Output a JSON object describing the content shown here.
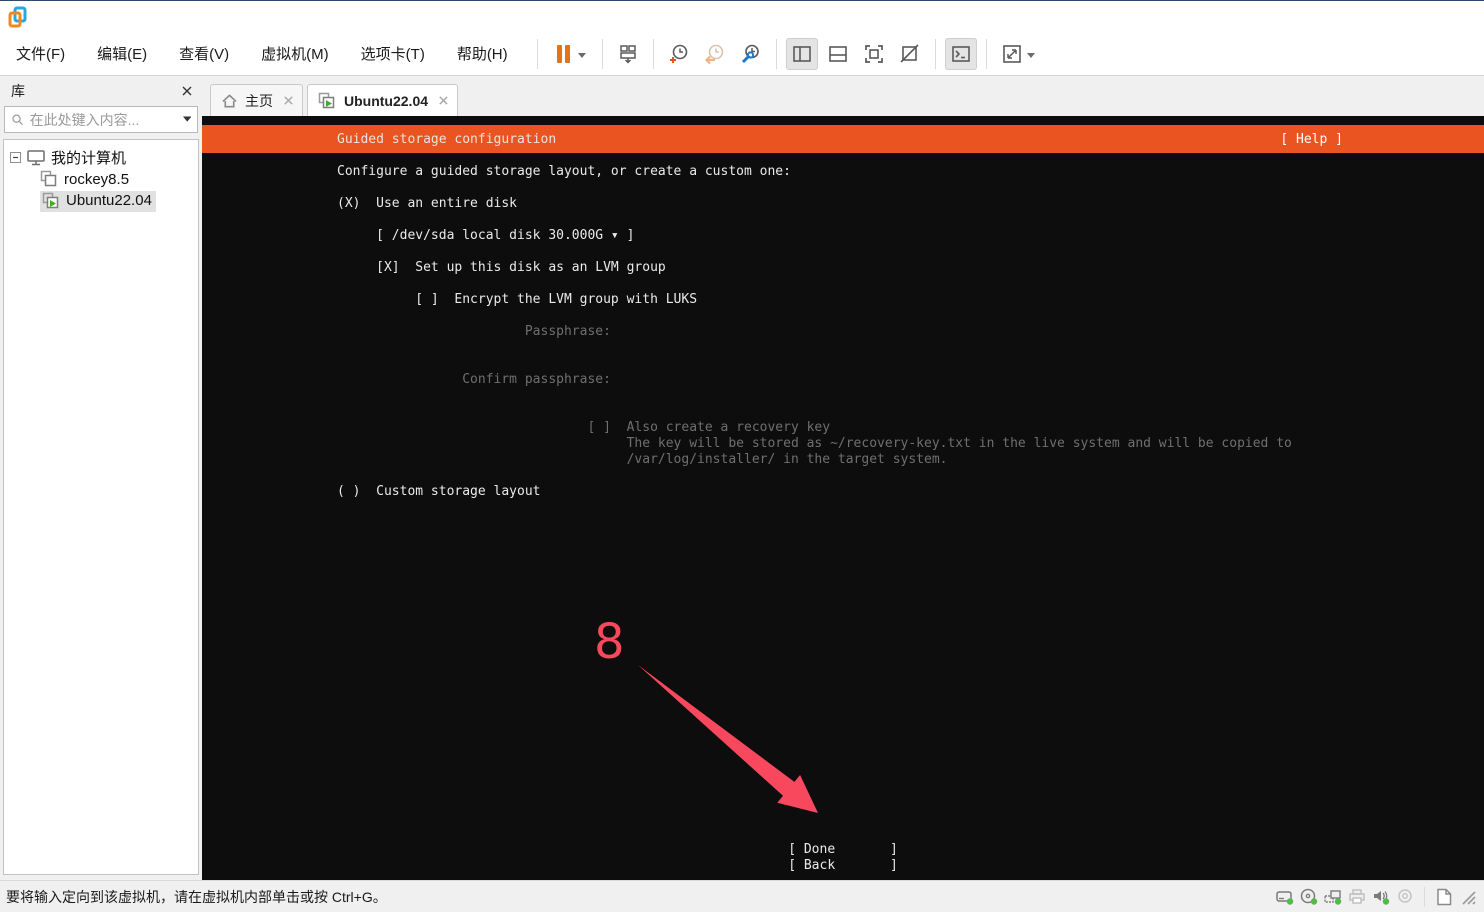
{
  "menu_bar": {
    "items": [
      {
        "label": "文件(F)"
      },
      {
        "label": "编辑(E)"
      },
      {
        "label": "查看(V)"
      },
      {
        "label": "虚拟机(M)"
      },
      {
        "label": "选项卡(T)"
      },
      {
        "label": "帮助(H)"
      }
    ]
  },
  "toolbar": {
    "icons": [
      "pause-button",
      "send-ctrl-alt-del-button",
      "take-snapshot-button",
      "revert-snapshot-button",
      "manage-snapshots-button",
      "show-library-toggle",
      "show-thumbnail-bar-toggle",
      "fullscreen-button",
      "unity-mode-button",
      "console-view-toggle",
      "fit-guest-button"
    ]
  },
  "tabs": [
    {
      "label": "主页",
      "icon": "home-icon"
    },
    {
      "label": "Ubuntu22.04",
      "icon": "vm-running-icon",
      "active": true
    }
  ],
  "sidebar": {
    "title": "库",
    "search_placeholder": "在此处键入内容...",
    "tree": {
      "root": "我的计算机",
      "children": [
        {
          "label": "rockey8.5",
          "state": "stopped"
        },
        {
          "label": "Ubuntu22.04",
          "state": "running",
          "selected": true
        }
      ]
    }
  },
  "installer": {
    "header_title": "Guided storage configuration",
    "help_label": "[ Help ]",
    "accent_color": "#E95420",
    "lines": [
      "Configure a guided storage layout, or create a custom one:",
      "",
      "(X)  Use an entire disk",
      "",
      "     [ /dev/sda local disk 30.000G ▾ ]",
      "",
      "     [X]  Set up this disk as an LVM group",
      "",
      "          [ ]  Encrypt the LVM group with LUKS",
      "",
      "                        Passphrase:",
      "",
      "",
      "                Confirm passphrase:",
      "",
      "",
      "                                [ ]  Also create a recovery key",
      "                                     The key will be stored as ~/recovery-key.txt in the live system and will be copied to",
      "                                     /var/log/installer/ in the target system.",
      "",
      "( )  Custom storage layout"
    ],
    "done_button": "[ Done       ]",
    "back_button": "[ Back       ]"
  },
  "annotation": {
    "number": "8",
    "color": "#F8485E"
  },
  "status_bar": {
    "message": "要将输入定向到该虚拟机，请在虚拟机内部单击或按 Ctrl+G。",
    "icons": [
      "hard-disk-icon",
      "cd-rom-icon",
      "network-adapter-icon",
      "printer-icon",
      "sound-icon",
      "webcam-icon",
      "message-icon",
      "resize-grip"
    ],
    "device_connected_color": "#54B948"
  }
}
